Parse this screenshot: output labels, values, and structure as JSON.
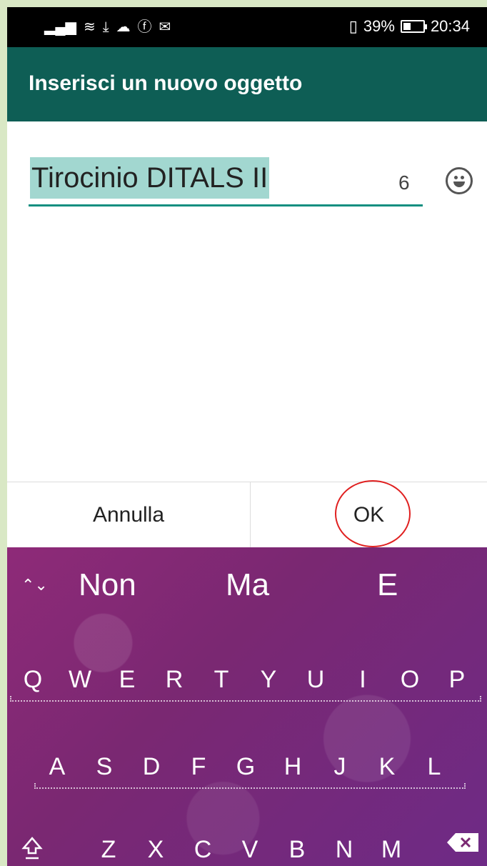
{
  "status_bar": {
    "battery_percent": "39%",
    "time": "20:34",
    "left_icons": [
      "signal-icon",
      "wifi-icon",
      "download-icon",
      "cloud-icon",
      "facebook-icon",
      "mail-icon"
    ]
  },
  "app_bar": {
    "title": "Inserisci un nuovo oggetto"
  },
  "input": {
    "value": "Tirocinio DITALS II",
    "char_count": "6"
  },
  "dialog": {
    "cancel_label": "Annulla",
    "ok_label": "OK"
  },
  "keyboard": {
    "suggestions": [
      "Non",
      "Ma",
      "E"
    ],
    "row1": [
      "Q",
      "W",
      "E",
      "R",
      "T",
      "Y",
      "U",
      "I",
      "O",
      "P"
    ],
    "row2": [
      "A",
      "S",
      "D",
      "F",
      "G",
      "H",
      "J",
      "K",
      "L"
    ],
    "row3": [
      "Z",
      "X",
      "C",
      "V",
      "B",
      "N",
      "M"
    ]
  },
  "colors": {
    "app_bar": "#0e5e55",
    "accent": "#0f8f80",
    "highlight": "#a2d7d0",
    "ok_circle": "#e02020"
  }
}
